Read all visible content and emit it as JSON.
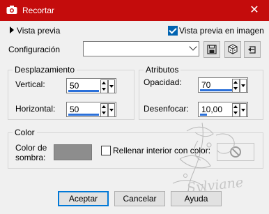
{
  "window": {
    "title": "Recortar",
    "icon": "camera-icon",
    "close_glyph": "✕"
  },
  "preview": {
    "toggle_label": "Vista previa",
    "live_label": "Vista previa en imagen",
    "live_checked": true
  },
  "config": {
    "label": "Configuración",
    "value": ""
  },
  "displacement": {
    "title": "Desplazamiento",
    "vertical_label": "Vertical:",
    "vertical_value": "50",
    "horizontal_label": "Horizontal:",
    "horizontal_value": "50"
  },
  "attributes": {
    "title": "Atributos",
    "opacity_label": "Opacidad:",
    "opacity_value": "70",
    "blur_label": "Desenfocar:",
    "blur_value": "10,00"
  },
  "color": {
    "title": "Color",
    "shadow_label_line1": "Color de",
    "shadow_label_line2": "sombra:",
    "shadow_color": "#8d8d8d",
    "fill_label": "Rellenar interior con color:",
    "fill_checked": false
  },
  "buttons": {
    "ok": "Aceptar",
    "cancel": "Cancelar",
    "help": "Ayuda"
  },
  "watermark": {
    "text": "Sylviane"
  }
}
